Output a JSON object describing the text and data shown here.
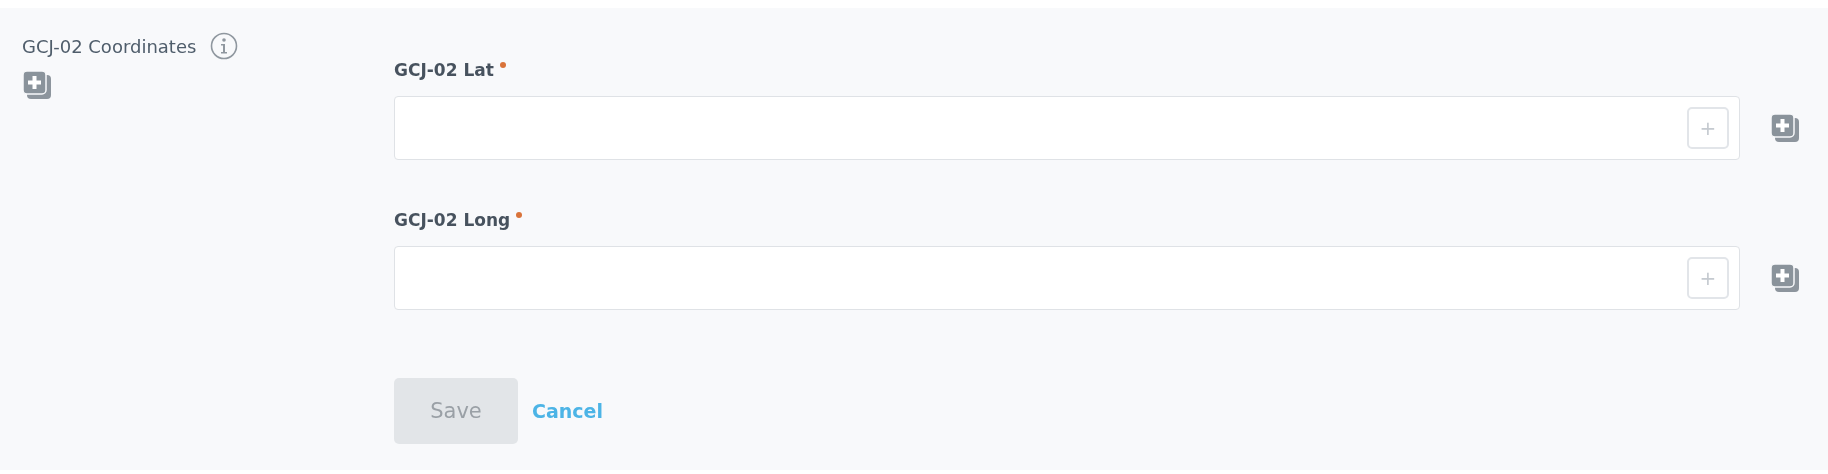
{
  "section": {
    "label": "GCJ-02 Coordinates"
  },
  "fields": [
    {
      "label": "GCJ-02 Lat",
      "required": true,
      "placeholder": "+"
    },
    {
      "label": "GCJ-02 Long",
      "required": true,
      "placeholder": "+"
    }
  ],
  "actions": {
    "save": {
      "label": "Save",
      "disabled": true
    },
    "cancel": {
      "label": "Cancel"
    }
  }
}
